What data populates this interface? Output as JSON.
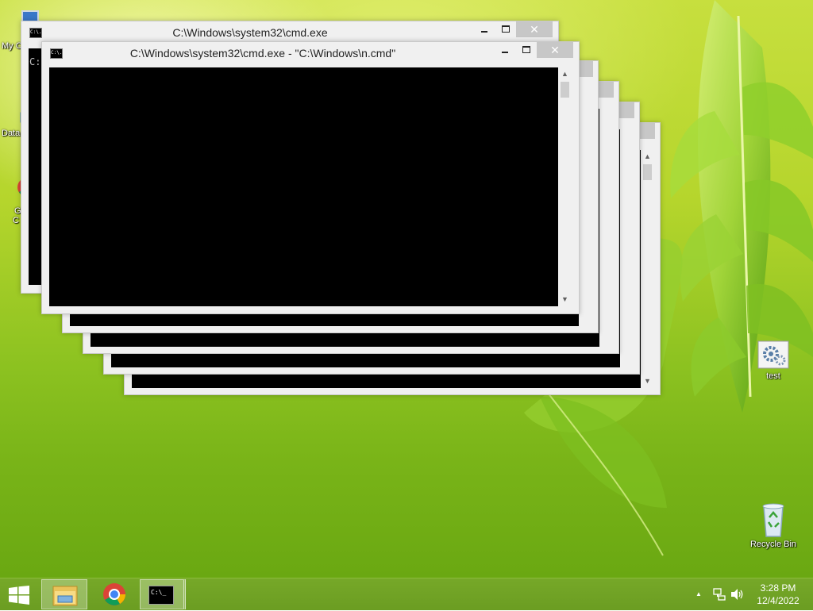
{
  "desktop": {
    "icons_left": [
      {
        "label": "My C"
      },
      {
        "label": "Data"
      },
      {
        "label": "G"
      },
      {
        "label": "C"
      }
    ],
    "icons_right": [
      {
        "label": "test",
        "icon": "settings-gear-icon"
      },
      {
        "label": "Recycle Bin",
        "icon": "recycle-bin-icon"
      }
    ]
  },
  "windows": {
    "back_title": "C:\\Windows\\system32\\cmd.exe",
    "back_console_text": "C:",
    "front_title": "C:\\Windows\\system32\\cmd.exe - \"C:\\Windows\\n.cmd\"",
    "icon_glyph": "C:\\.",
    "close_glyph": "✕",
    "scroll_up_glyph": "▲",
    "scroll_down_glyph": "▼"
  },
  "taskbar": {
    "start_icon": "windows-logo-icon",
    "pinned": [
      {
        "name": "file-explorer",
        "icon": "folder-icon"
      },
      {
        "name": "chrome",
        "icon": "chrome-icon"
      },
      {
        "name": "command-prompt",
        "icon": "cmd-icon",
        "active": true,
        "glyph": "C:\\_"
      }
    ],
    "tray": {
      "show_hidden_glyph": "▲",
      "network_icon": "network-icon",
      "volume_icon": "speaker-icon"
    },
    "clock": {
      "time": "3:28 PM",
      "date": "12/4/2022"
    }
  },
  "colors": {
    "taskbar": "#6b9d22",
    "console": "#000000",
    "window_frame": "#f0f0f0",
    "close_button": "#c7c7c7"
  }
}
